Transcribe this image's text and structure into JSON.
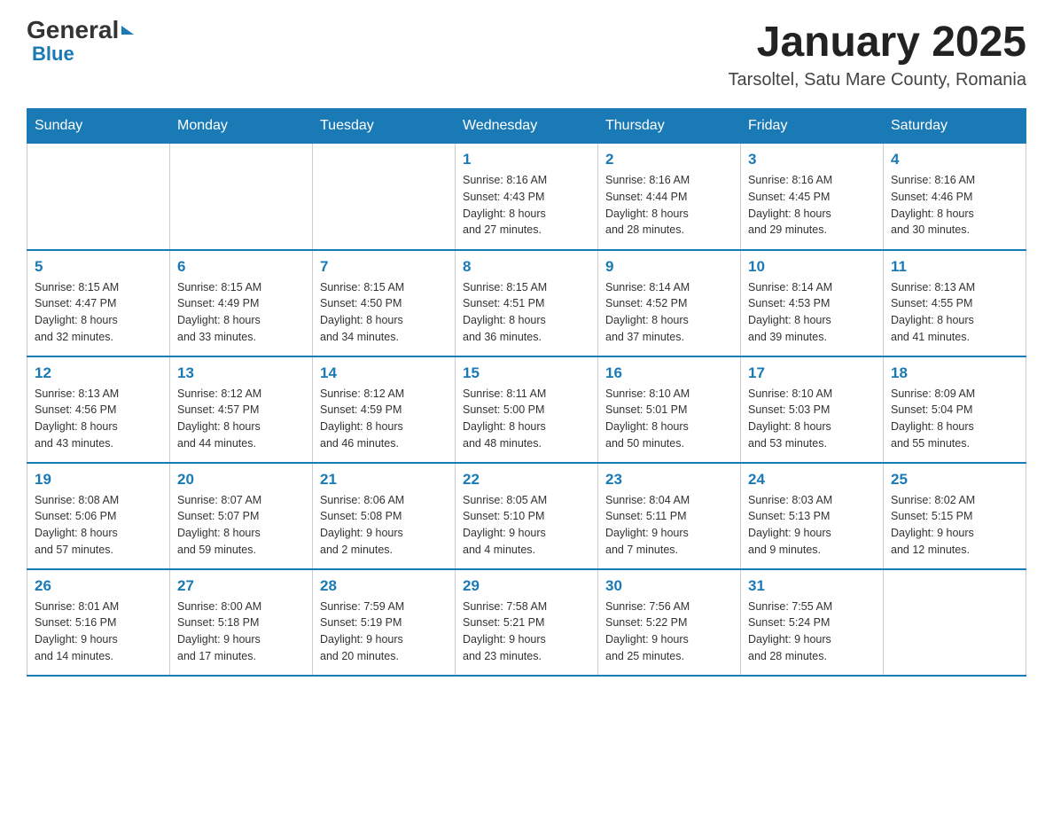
{
  "header": {
    "logo_text_general": "General",
    "logo_text_blue": "Blue",
    "month": "January 2025",
    "location": "Tarsoltel, Satu Mare County, Romania"
  },
  "days_of_week": [
    "Sunday",
    "Monday",
    "Tuesday",
    "Wednesday",
    "Thursday",
    "Friday",
    "Saturday"
  ],
  "weeks": [
    [
      {
        "day": "",
        "info": ""
      },
      {
        "day": "",
        "info": ""
      },
      {
        "day": "",
        "info": ""
      },
      {
        "day": "1",
        "info": "Sunrise: 8:16 AM\nSunset: 4:43 PM\nDaylight: 8 hours\nand 27 minutes."
      },
      {
        "day": "2",
        "info": "Sunrise: 8:16 AM\nSunset: 4:44 PM\nDaylight: 8 hours\nand 28 minutes."
      },
      {
        "day": "3",
        "info": "Sunrise: 8:16 AM\nSunset: 4:45 PM\nDaylight: 8 hours\nand 29 minutes."
      },
      {
        "day": "4",
        "info": "Sunrise: 8:16 AM\nSunset: 4:46 PM\nDaylight: 8 hours\nand 30 minutes."
      }
    ],
    [
      {
        "day": "5",
        "info": "Sunrise: 8:15 AM\nSunset: 4:47 PM\nDaylight: 8 hours\nand 32 minutes."
      },
      {
        "day": "6",
        "info": "Sunrise: 8:15 AM\nSunset: 4:49 PM\nDaylight: 8 hours\nand 33 minutes."
      },
      {
        "day": "7",
        "info": "Sunrise: 8:15 AM\nSunset: 4:50 PM\nDaylight: 8 hours\nand 34 minutes."
      },
      {
        "day": "8",
        "info": "Sunrise: 8:15 AM\nSunset: 4:51 PM\nDaylight: 8 hours\nand 36 minutes."
      },
      {
        "day": "9",
        "info": "Sunrise: 8:14 AM\nSunset: 4:52 PM\nDaylight: 8 hours\nand 37 minutes."
      },
      {
        "day": "10",
        "info": "Sunrise: 8:14 AM\nSunset: 4:53 PM\nDaylight: 8 hours\nand 39 minutes."
      },
      {
        "day": "11",
        "info": "Sunrise: 8:13 AM\nSunset: 4:55 PM\nDaylight: 8 hours\nand 41 minutes."
      }
    ],
    [
      {
        "day": "12",
        "info": "Sunrise: 8:13 AM\nSunset: 4:56 PM\nDaylight: 8 hours\nand 43 minutes."
      },
      {
        "day": "13",
        "info": "Sunrise: 8:12 AM\nSunset: 4:57 PM\nDaylight: 8 hours\nand 44 minutes."
      },
      {
        "day": "14",
        "info": "Sunrise: 8:12 AM\nSunset: 4:59 PM\nDaylight: 8 hours\nand 46 minutes."
      },
      {
        "day": "15",
        "info": "Sunrise: 8:11 AM\nSunset: 5:00 PM\nDaylight: 8 hours\nand 48 minutes."
      },
      {
        "day": "16",
        "info": "Sunrise: 8:10 AM\nSunset: 5:01 PM\nDaylight: 8 hours\nand 50 minutes."
      },
      {
        "day": "17",
        "info": "Sunrise: 8:10 AM\nSunset: 5:03 PM\nDaylight: 8 hours\nand 53 minutes."
      },
      {
        "day": "18",
        "info": "Sunrise: 8:09 AM\nSunset: 5:04 PM\nDaylight: 8 hours\nand 55 minutes."
      }
    ],
    [
      {
        "day": "19",
        "info": "Sunrise: 8:08 AM\nSunset: 5:06 PM\nDaylight: 8 hours\nand 57 minutes."
      },
      {
        "day": "20",
        "info": "Sunrise: 8:07 AM\nSunset: 5:07 PM\nDaylight: 8 hours\nand 59 minutes."
      },
      {
        "day": "21",
        "info": "Sunrise: 8:06 AM\nSunset: 5:08 PM\nDaylight: 9 hours\nand 2 minutes."
      },
      {
        "day": "22",
        "info": "Sunrise: 8:05 AM\nSunset: 5:10 PM\nDaylight: 9 hours\nand 4 minutes."
      },
      {
        "day": "23",
        "info": "Sunrise: 8:04 AM\nSunset: 5:11 PM\nDaylight: 9 hours\nand 7 minutes."
      },
      {
        "day": "24",
        "info": "Sunrise: 8:03 AM\nSunset: 5:13 PM\nDaylight: 9 hours\nand 9 minutes."
      },
      {
        "day": "25",
        "info": "Sunrise: 8:02 AM\nSunset: 5:15 PM\nDaylight: 9 hours\nand 12 minutes."
      }
    ],
    [
      {
        "day": "26",
        "info": "Sunrise: 8:01 AM\nSunset: 5:16 PM\nDaylight: 9 hours\nand 14 minutes."
      },
      {
        "day": "27",
        "info": "Sunrise: 8:00 AM\nSunset: 5:18 PM\nDaylight: 9 hours\nand 17 minutes."
      },
      {
        "day": "28",
        "info": "Sunrise: 7:59 AM\nSunset: 5:19 PM\nDaylight: 9 hours\nand 20 minutes."
      },
      {
        "day": "29",
        "info": "Sunrise: 7:58 AM\nSunset: 5:21 PM\nDaylight: 9 hours\nand 23 minutes."
      },
      {
        "day": "30",
        "info": "Sunrise: 7:56 AM\nSunset: 5:22 PM\nDaylight: 9 hours\nand 25 minutes."
      },
      {
        "day": "31",
        "info": "Sunrise: 7:55 AM\nSunset: 5:24 PM\nDaylight: 9 hours\nand 28 minutes."
      },
      {
        "day": "",
        "info": ""
      }
    ]
  ]
}
